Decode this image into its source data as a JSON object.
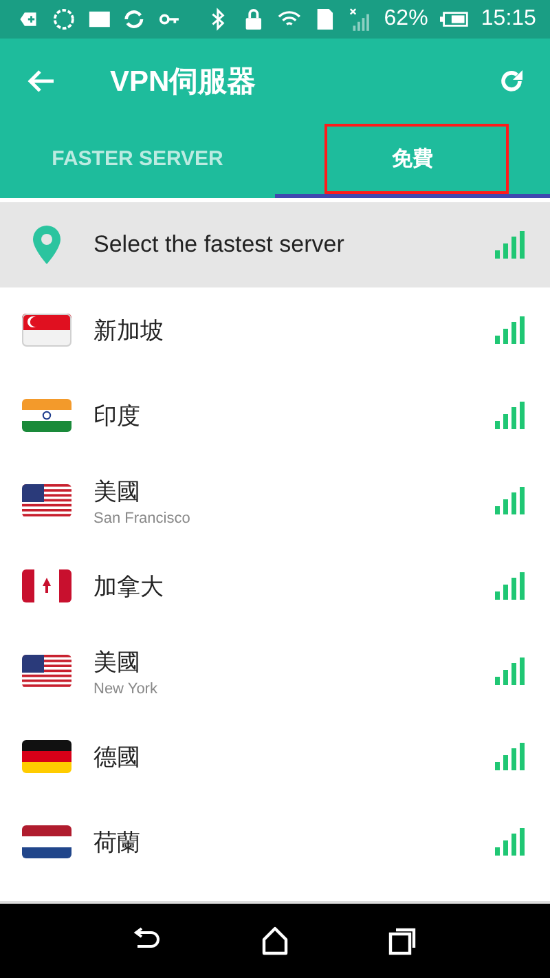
{
  "status_bar": {
    "battery": "62%",
    "time": "15:15"
  },
  "app_bar": {
    "title": "VPN伺服器"
  },
  "tabs": [
    {
      "label": "FASTER SERVER",
      "selected": false,
      "highlighted": false
    },
    {
      "label": "免費",
      "selected": true,
      "highlighted": true
    }
  ],
  "servers": [
    {
      "kind": "auto",
      "name": "Select the fastest server",
      "selected": true
    },
    {
      "kind": "sg",
      "name": "新加坡",
      "selected": false
    },
    {
      "kind": "in",
      "name": "印度",
      "selected": false
    },
    {
      "kind": "us",
      "name": "美國",
      "city": "San Francisco",
      "selected": false
    },
    {
      "kind": "ca",
      "name": "加拿大",
      "selected": false
    },
    {
      "kind": "us",
      "name": "美國",
      "city": "New York",
      "selected": false
    },
    {
      "kind": "de",
      "name": "德國",
      "selected": false
    },
    {
      "kind": "nl",
      "name": "荷蘭",
      "selected": false
    }
  ]
}
